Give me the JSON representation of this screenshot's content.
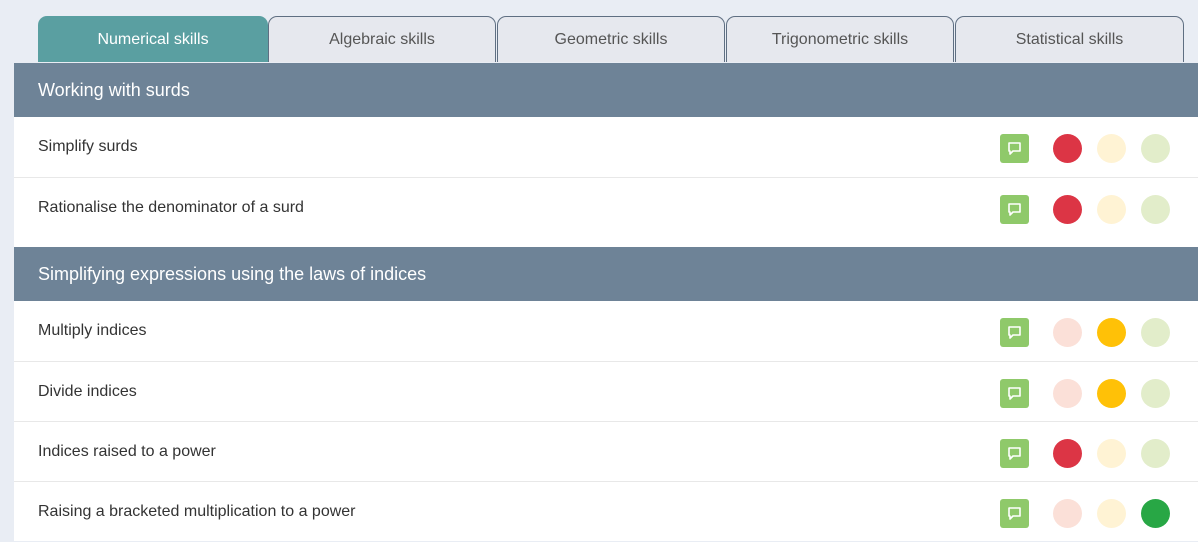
{
  "tabs": [
    {
      "label": "Numerical skills",
      "active": true
    },
    {
      "label": "Algebraic skills",
      "active": false
    },
    {
      "label": "Geometric skills",
      "active": false
    },
    {
      "label": "Trigonometric skills",
      "active": false
    },
    {
      "label": "Statistical skills",
      "active": false
    }
  ],
  "colors": {
    "red_on": "#dc3545",
    "red_off": "#fbe0d8",
    "amber_on": "#ffc107",
    "amber_off": "#fff3d4",
    "green_on": "#28a745",
    "green_off": "#e2edca",
    "comment": "#8fc96a",
    "header": "#6e8397",
    "tab_active": "#5a9fa1"
  },
  "sections": [
    {
      "title": "Working with surds",
      "rows": [
        {
          "label": "Simplify surds",
          "rating": "red"
        },
        {
          "label": "Rationalise the denominator of a surd",
          "rating": "red"
        }
      ]
    },
    {
      "title": "Simplifying expressions using the laws of indices",
      "rows": [
        {
          "label": "Multiply indices",
          "rating": "amber"
        },
        {
          "label": "Divide indices",
          "rating": "amber"
        },
        {
          "label": "Indices raised to a power",
          "rating": "red"
        },
        {
          "label": "Raising a bracketed multiplication to a power",
          "rating": "green"
        }
      ]
    }
  ]
}
